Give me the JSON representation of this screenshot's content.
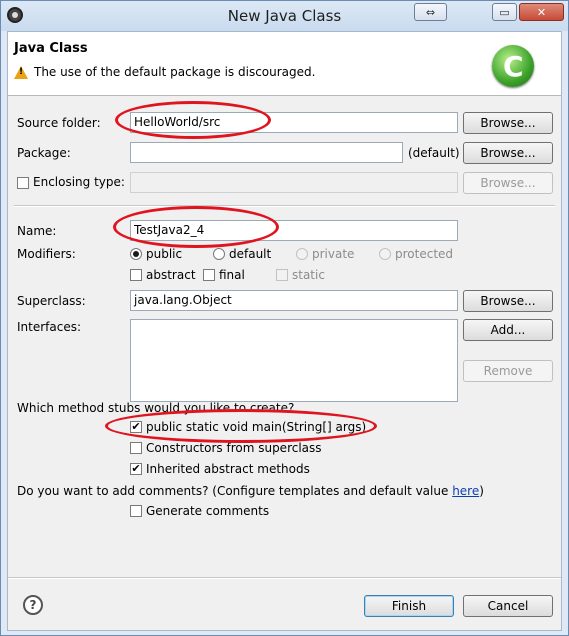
{
  "window": {
    "title": "New Java Class",
    "buttons": {
      "restore": "⇔",
      "minimize": "▭",
      "close": "✕"
    }
  },
  "header": {
    "title": "Java Class",
    "message": "The use of the default package is discouraged.",
    "logo_icon": "new-class-wizard-icon"
  },
  "form": {
    "source_folder": {
      "label": "Source folder:",
      "value": "HelloWorld/src",
      "button": "Browse..."
    },
    "package": {
      "label": "Package:",
      "value": "",
      "suffix": "(default)",
      "button": "Browse..."
    },
    "enclosing": {
      "label": "Enclosing type:",
      "value": "",
      "button": "Browse..."
    },
    "name": {
      "label": "Name:",
      "value": "TestJava2_4"
    },
    "modifiers": {
      "label": "Modifiers:",
      "public": "public",
      "default": "default",
      "private": "private",
      "protected": "protected",
      "abstract": "abstract",
      "final": "final",
      "static": "static",
      "selected": "public"
    },
    "superclass": {
      "label": "Superclass:",
      "value": "java.lang.Object",
      "button": "Browse..."
    },
    "interfaces": {
      "label": "Interfaces:",
      "add_button": "Add...",
      "remove_button": "Remove"
    }
  },
  "stubs": {
    "question": "Which method stubs would you like to create?",
    "main": {
      "label": "public static void main(String[] args)",
      "checked": true
    },
    "constructors": {
      "label": "Constructors from superclass",
      "checked": false
    },
    "inherited": {
      "label": "Inherited abstract methods",
      "checked": true
    }
  },
  "comments": {
    "question": "Do you want to add comments? (Configure templates and default value ",
    "link": "here",
    "question_end": ")",
    "generate": {
      "label": "Generate comments",
      "checked": false
    }
  },
  "footer": {
    "finish": "Finish",
    "cancel": "Cancel"
  },
  "annotation_color": "#e0141e"
}
